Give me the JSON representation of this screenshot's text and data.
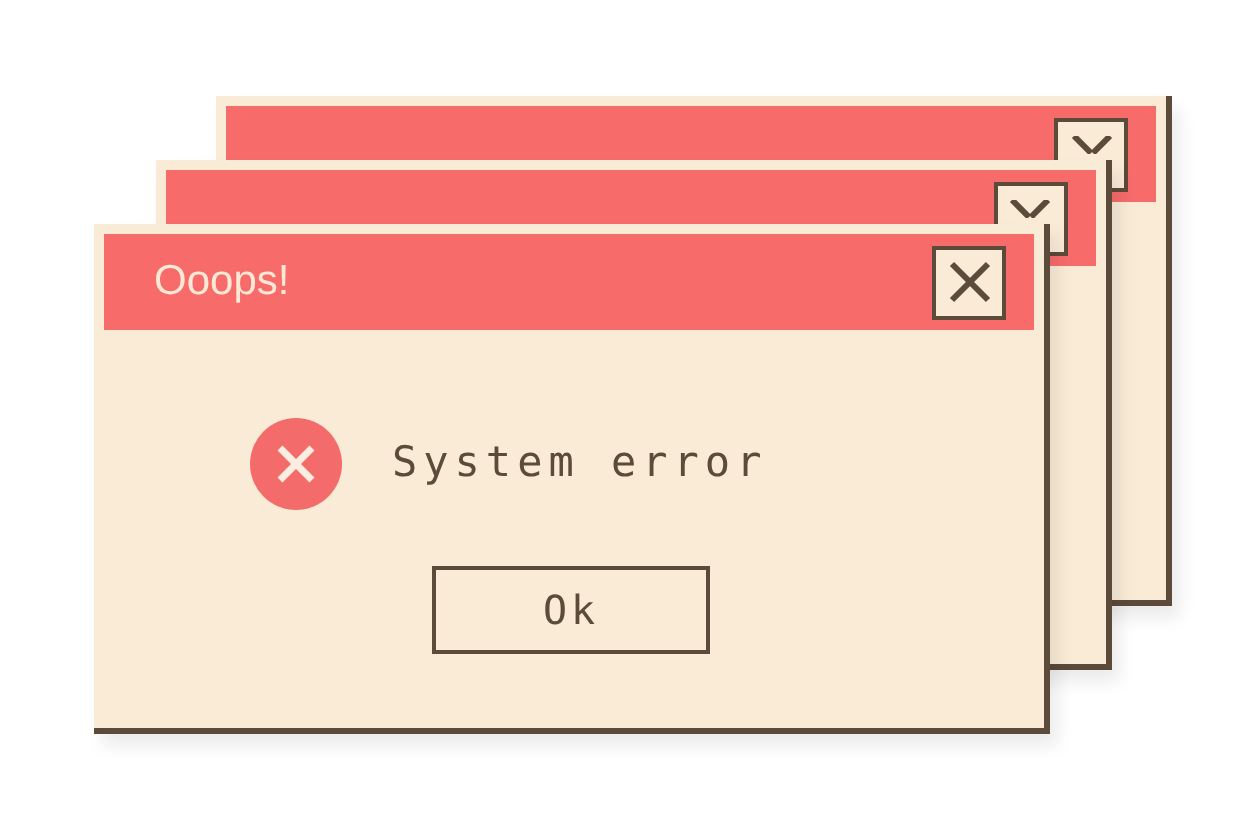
{
  "windows": [
    {
      "kind": "back"
    },
    {
      "kind": "back"
    },
    {
      "kind": "front",
      "title": "Ooops!",
      "message": "System error",
      "button": "Ok"
    }
  ]
}
